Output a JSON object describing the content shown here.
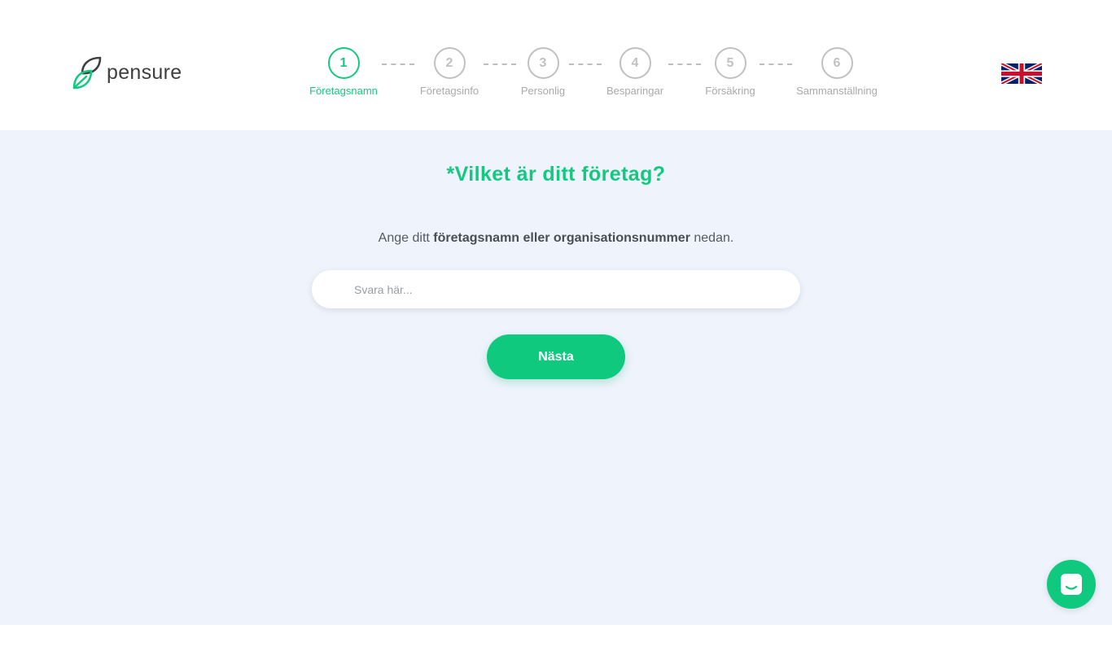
{
  "brand": {
    "name": "pensure",
    "accent_color": "#14c97f"
  },
  "steps": [
    {
      "number": "1",
      "label": "Företagsnamn",
      "active": true
    },
    {
      "number": "2",
      "label": "Företagsinfo",
      "active": false
    },
    {
      "number": "3",
      "label": "Personlig",
      "active": false
    },
    {
      "number": "4",
      "label": "Besparingar",
      "active": false
    },
    {
      "number": "5",
      "label": "Försäkring",
      "active": false
    },
    {
      "number": "6",
      "label": "Sammanställning",
      "active": false
    }
  ],
  "language": {
    "icon": "uk-flag-icon"
  },
  "main": {
    "question": "*Vilket är ditt företag?",
    "instruction_pre": "Ange ditt ",
    "instruction_bold": "företagsnamn eller organisationsnummer",
    "instruction_post": " nedan.",
    "input_placeholder": "Svara här...",
    "input_value": "",
    "next_label": "Nästa"
  },
  "chat": {
    "icon": "chat-icon"
  }
}
